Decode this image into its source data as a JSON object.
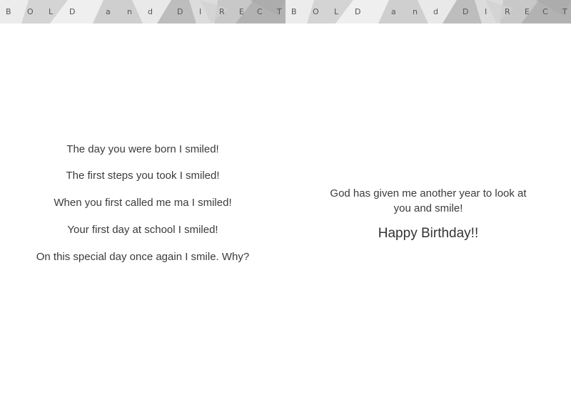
{
  "banner": {
    "letters": [
      "B",
      "O",
      "L",
      "D",
      "a",
      "n",
      "d",
      "D",
      "I",
      "R",
      "E",
      "C",
      "T"
    ]
  },
  "left_panel": {
    "lines": [
      "The day you were born I smiled!",
      "The first steps you took I smiled!",
      "When you first called me ma I smiled!",
      "Your first day at school I smiled!",
      "On this special day once again I smile.  Why?"
    ]
  },
  "right_panel": {
    "message": "God has given me another year to look at you and smile!",
    "wish": "Happy Birthday!!"
  },
  "colors": {
    "banner_background": "#e4e4e4",
    "text": "#3b3b3b"
  }
}
